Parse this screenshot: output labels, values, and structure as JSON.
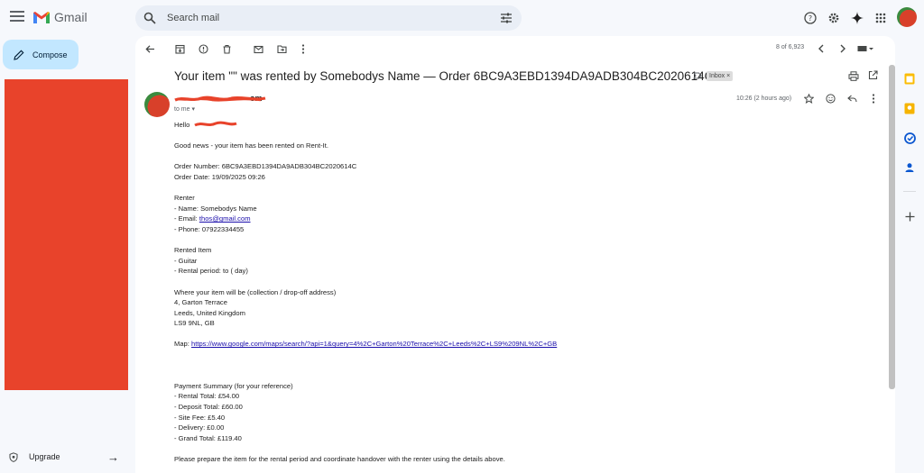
{
  "app": {
    "name": "Gmail"
  },
  "search": {
    "placeholder": "Search mail"
  },
  "compose": {
    "label": "Compose"
  },
  "upgrade": {
    "label": "Upgrade"
  },
  "pager": {
    "text": "8 of 6,923"
  },
  "email": {
    "subject": "Your item \"\" was rented by Somebodys Name — Order 6BC9A3EBD1394DA9ADB304BC2020614C",
    "label": "Inbox ×",
    "sender_suffix": "om",
    "to": "to me",
    "time": "10:26 (2 hours ago)",
    "greeting": "Hello",
    "lines": [
      "Good news - your item has been rented on Rent-It.",
      "Order Number: 6BC9A3EBD1394DA9ADB304BC2020614C",
      "Order Date: 19/09/2025 09:26",
      "Renter",
      "- Name: Somebodys Name",
      "- Email: ",
      "thos@gmail.com",
      "- Phone: 07922334455",
      "Rented Item",
      "- Guitar",
      "- Rental period:  to  ( day)",
      "Where your item will be (collection / drop-off address)",
      "4, Garton Terrace",
      "Leeds, United Kingdom",
      "LS9 9NL, GB",
      "Map: ",
      "https://www.google.com/maps/search/?api=1&query=4%2C+Garton%20Terrace%2C+Leeds%2C+LS9%209NL%2C+GB",
      "Payment Summary (for your reference)",
      "- Rental Total: £54.00",
      "- Deposit Total: £60.00",
      "- Site Fee: £5.40",
      "- Delivery: £0.00",
      "- Grand Total: £119.40",
      "Please prepare the item for the rental period and coordinate handover with the renter using the details above."
    ]
  },
  "colors": {
    "accent": "#c2e7ff",
    "redacted": "#e8432b",
    "link": "#1a0dab"
  }
}
